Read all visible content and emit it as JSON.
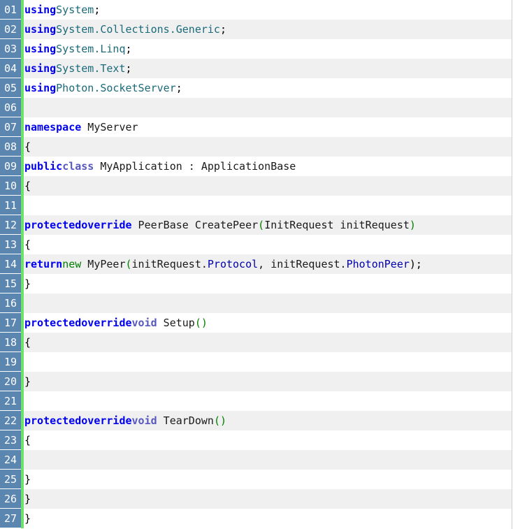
{
  "editor": {
    "lines": [
      {
        "number": "01",
        "tokens": [
          {
            "t": "using",
            "k": "keyword"
          },
          {
            "t": "System",
            "k": "type"
          },
          {
            "t": ";",
            "k": "punct"
          }
        ]
      },
      {
        "number": "02",
        "tokens": [
          {
            "t": "using",
            "k": "keyword"
          },
          {
            "t": "System.Collections.Generic",
            "k": "type"
          },
          {
            "t": ";",
            "k": "punct"
          }
        ]
      },
      {
        "number": "03",
        "tokens": [
          {
            "t": "using",
            "k": "keyword"
          },
          {
            "t": "System.Linq",
            "k": "type"
          },
          {
            "t": ";",
            "k": "punct"
          }
        ]
      },
      {
        "number": "04",
        "tokens": [
          {
            "t": "using",
            "k": "keyword"
          },
          {
            "t": "System.Text",
            "k": "type"
          },
          {
            "t": ";",
            "k": "punct"
          }
        ]
      },
      {
        "number": "05",
        "tokens": [
          {
            "t": "using",
            "k": "keyword"
          },
          {
            "t": "Photon.SocketServer",
            "k": "type"
          },
          {
            "t": ";",
            "k": "punct"
          }
        ]
      },
      {
        "number": "06",
        "tokens": []
      },
      {
        "number": "07",
        "tokens": [
          {
            "t": "namespace",
            "k": "keyword"
          },
          {
            "t": " MyServer",
            "k": "ident"
          }
        ]
      },
      {
        "number": "08",
        "tokens": [
          {
            "t": "{",
            "k": "punct"
          }
        ]
      },
      {
        "number": "09",
        "tokens": [
          {
            "t": "public",
            "k": "keyword"
          },
          {
            "t": "class",
            "k": "void"
          },
          {
            "t": " MyApplication : ApplicationBase",
            "k": "ident"
          }
        ]
      },
      {
        "number": "10",
        "tokens": [
          {
            "t": "{",
            "k": "punct"
          }
        ]
      },
      {
        "number": "11",
        "tokens": []
      },
      {
        "number": "12",
        "tokens": [
          {
            "t": "protectedoverride",
            "k": "keyword"
          },
          {
            "t": " PeerBase CreatePeer",
            "k": "ident"
          },
          {
            "t": "(",
            "k": "bracket"
          },
          {
            "t": "InitRequest initRequest",
            "k": "ident"
          },
          {
            "t": ")",
            "k": "bracket"
          }
        ]
      },
      {
        "number": "13",
        "tokens": [
          {
            "t": "{",
            "k": "punct"
          }
        ]
      },
      {
        "number": "14",
        "tokens": [
          {
            "t": "return",
            "k": "keyword"
          },
          {
            "t": "new",
            "k": "new"
          },
          {
            "t": " MyPeer",
            "k": "ident"
          },
          {
            "t": "(",
            "k": "bracket"
          },
          {
            "t": "initRequest.",
            "k": "ident"
          },
          {
            "t": "Protocol",
            "k": "member"
          },
          {
            "t": ", initRequest.",
            "k": "ident"
          },
          {
            "t": "PhotonPeer",
            "k": "member"
          },
          {
            "t": ");",
            "k": "punct"
          }
        ]
      },
      {
        "number": "15",
        "tokens": [
          {
            "t": "}",
            "k": "punct"
          }
        ]
      },
      {
        "number": "16",
        "tokens": []
      },
      {
        "number": "17",
        "tokens": [
          {
            "t": "protectedoverride",
            "k": "keyword"
          },
          {
            "t": "void",
            "k": "void"
          },
          {
            "t": " Setup",
            "k": "ident"
          },
          {
            "t": "()",
            "k": "bracket"
          }
        ]
      },
      {
        "number": "18",
        "tokens": [
          {
            "t": "{",
            "k": "punct"
          }
        ]
      },
      {
        "number": "19",
        "tokens": []
      },
      {
        "number": "20",
        "tokens": [
          {
            "t": "}",
            "k": "punct"
          }
        ]
      },
      {
        "number": "21",
        "tokens": []
      },
      {
        "number": "22",
        "tokens": [
          {
            "t": "protectedoverride",
            "k": "keyword"
          },
          {
            "t": "void",
            "k": "void"
          },
          {
            "t": " TearDown",
            "k": "ident"
          },
          {
            "t": "()",
            "k": "bracket"
          }
        ]
      },
      {
        "number": "23",
        "tokens": [
          {
            "t": "{",
            "k": "punct"
          }
        ]
      },
      {
        "number": "24",
        "tokens": []
      },
      {
        "number": "25",
        "tokens": [
          {
            "t": "}",
            "k": "punct"
          }
        ]
      },
      {
        "number": "26",
        "tokens": [
          {
            "t": "}",
            "k": "punct"
          }
        ]
      },
      {
        "number": "27",
        "tokens": [
          {
            "t": "}",
            "k": "punct"
          }
        ]
      }
    ]
  },
  "colors": {
    "line_number_bg": "#5b86b0",
    "gutter_bar": "#6ce26c",
    "alt_row_bg": "#f0f0f0"
  }
}
